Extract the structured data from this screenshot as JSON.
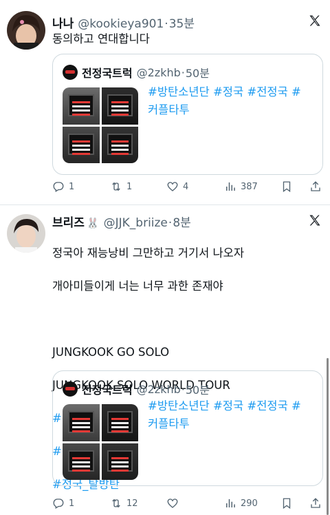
{
  "tweets": [
    {
      "name": "나나",
      "handle": "@kookieya901",
      "sep": "·",
      "time": "35분",
      "text": "동의하고 연대합니다",
      "quote": {
        "name": "전정국트럭",
        "handle": "@2zkhb",
        "sep": "·",
        "time": "50분",
        "text_line1": "#방탄소년단 #정국 #전정국 #",
        "text_line2": "커플타투"
      },
      "reply_count": "1",
      "retweet_count": "1",
      "like_count": "4",
      "view_count": "387"
    },
    {
      "name": "브리즈",
      "emoji": "🐰",
      "handle": "@JJK_briize",
      "sep": "·",
      "time": "8분",
      "text_lines": [
        "정국아 재능낭비 그만하고 거기서 나오자",
        "개아미들이게 너는 너무 과한 존재야",
        "",
        "JUNGKOOK GO SOLO",
        "JUNGKOOK SOLO WORLD TOUR"
      ],
      "hashtags": [
        "#정국_탈빅히트",
        "#정국_탈하이브",
        "#정국_탈방탄"
      ],
      "quote": {
        "name": "전정국트럭",
        "handle": "@2zkhb",
        "sep": "·",
        "time": "50분",
        "text_line1": "#방탄소년단 #정국 #전정국 #",
        "text_line2": "커플타투"
      },
      "reply_count": "1",
      "retweet_count": "12",
      "like_count": "",
      "view_count": "290"
    }
  ],
  "colors": {
    "link": "#1d9bf0",
    "muted": "#536471",
    "text": "#0f1419",
    "border": "#cfd9de"
  },
  "icons": [
    "x-logo-icon",
    "reply-icon",
    "retweet-icon",
    "like-icon",
    "views-icon",
    "bookmark-icon",
    "share-icon"
  ]
}
